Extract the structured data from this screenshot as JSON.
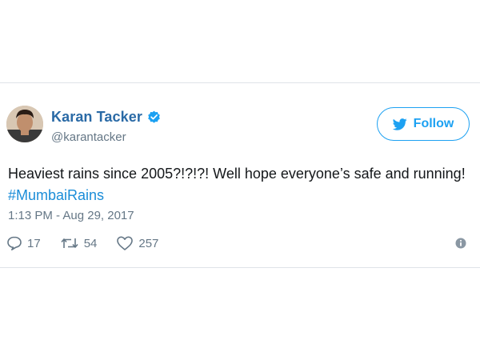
{
  "tweet": {
    "display_name": "Karan Tacker",
    "handle": "@karantacker",
    "follow_label": "Follow",
    "text_main": "Heaviest rains since 2005?!?!?! Well hope everyone’s safe and running! ",
    "hashtag": "#MumbaiRains",
    "timestamp": "1:13 PM - Aug 29, 2017",
    "stats": {
      "replies": "17",
      "retweets": "54",
      "likes": "257"
    }
  },
  "icons": {
    "verified": "verified-badge-icon",
    "follow": "twitter-bird-icon",
    "reply": "reply-icon",
    "retweet": "retweet-icon",
    "like": "heart-icon",
    "info": "info-icon"
  },
  "colors": {
    "name": "#2a6aa6",
    "accent": "#1da1f2",
    "hashtag": "#1b8dd8",
    "muted": "#657786",
    "text": "#14171a",
    "border": "#dfe3e8"
  }
}
